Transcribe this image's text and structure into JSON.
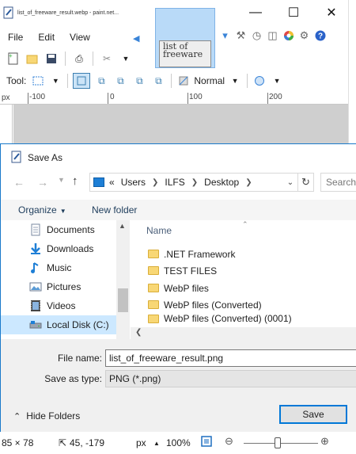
{
  "paint_window": {
    "title": "list_of_freeware_result.webp - paint.net...",
    "window_controls": {
      "minimize": "—",
      "maximize": "☐",
      "close": "✕"
    },
    "menu": [
      "File",
      "Edit",
      "View"
    ],
    "thumbnail_text_line1": "list of",
    "thumbnail_text_line2": "freeware",
    "toolbar_tool_label": "Tool:",
    "blend_mode": "Normal",
    "ruler_unit": "px",
    "ruler_ticks": [
      "-100",
      "0",
      "100",
      "200"
    ]
  },
  "save_dialog": {
    "title": "Save As",
    "address": {
      "prefix": "«",
      "segments": [
        "Users",
        "ILFS",
        "Desktop"
      ]
    },
    "search_placeholder": "Search",
    "commands": {
      "organize": "Organize",
      "new_folder": "New folder"
    },
    "nav_items": [
      {
        "label": "Documents",
        "icon": "documents-icon"
      },
      {
        "label": "Downloads",
        "icon": "downloads-icon"
      },
      {
        "label": "Music",
        "icon": "music-icon"
      },
      {
        "label": "Pictures",
        "icon": "pictures-icon"
      },
      {
        "label": "Videos",
        "icon": "videos-icon"
      },
      {
        "label": "Local Disk (C:)",
        "icon": "drive-icon"
      }
    ],
    "column_header": "Name",
    "files": [
      ".NET Framework",
      "TEST FILES",
      "WebP files",
      "WebP files (Converted)",
      "WebP files (Converted) (0001)"
    ],
    "file_name_label": "File name:",
    "file_name_value": "list_of_freeware_result.png",
    "save_type_label": "Save as type:",
    "save_type_value": "PNG (*.png)",
    "hide_folders": "Hide Folders",
    "save_button": "Save"
  },
  "status_bar": {
    "size": "85 × 78",
    "cursor": "45, -179",
    "unit": "px",
    "zoom": "100%"
  },
  "colors": {
    "accent": "#0078d7",
    "selected_bg": "#cce8ff",
    "folder": "#f8d775"
  }
}
